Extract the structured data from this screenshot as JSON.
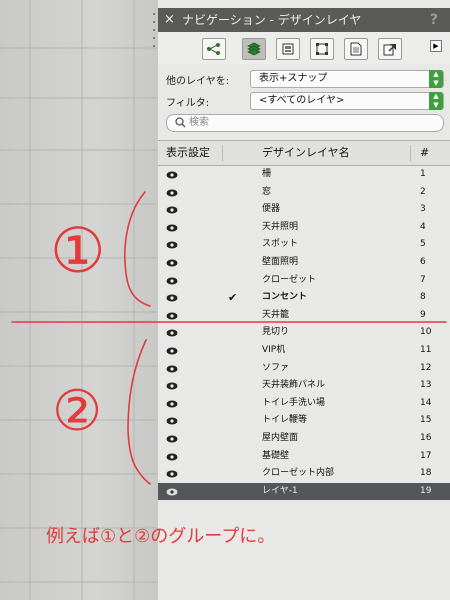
{
  "panel": {
    "close_glyph": "×",
    "title": "ナビゲーション - デザインレイヤ",
    "help_glyph": "?"
  },
  "toolbar": {
    "buttons": [
      {
        "icon": "hierarchy-icon"
      },
      {
        "icon": "layers-icon",
        "active": true
      },
      {
        "icon": "sheet-icon"
      },
      {
        "icon": "viewport-icon"
      },
      {
        "icon": "document-icon"
      },
      {
        "icon": "export-icon"
      }
    ],
    "arrow_glyph": "▶"
  },
  "other_layers": {
    "label": "他のレイヤを:",
    "value": "表示+スナップ"
  },
  "filter": {
    "label": "フィルタ:",
    "value": "<すべてのレイヤ>"
  },
  "search": {
    "placeholder": "検索"
  },
  "header": {
    "visibility": "表示設定",
    "name": "デザインレイヤ名",
    "number": "#"
  },
  "layers": [
    {
      "name": "柵",
      "number": "1",
      "checked": false,
      "selected": false
    },
    {
      "name": "窓",
      "number": "2",
      "checked": false,
      "selected": false
    },
    {
      "name": "便器",
      "number": "3",
      "checked": false,
      "selected": false
    },
    {
      "name": "天井照明",
      "number": "4",
      "checked": false,
      "selected": false
    },
    {
      "name": "スポット",
      "number": "5",
      "checked": false,
      "selected": false
    },
    {
      "name": "壁面照明",
      "number": "6",
      "checked": false,
      "selected": false
    },
    {
      "name": "クローゼット",
      "number": "7",
      "checked": false,
      "selected": false
    },
    {
      "name": "コンセント",
      "number": "8",
      "checked": true,
      "selected": false
    },
    {
      "name": "天井籠",
      "number": "9",
      "checked": false,
      "selected": false
    },
    {
      "name": "見切り",
      "number": "10",
      "checked": false,
      "selected": false
    },
    {
      "name": "VIP机",
      "number": "11",
      "checked": false,
      "selected": false
    },
    {
      "name": "ソファ",
      "number": "12",
      "checked": false,
      "selected": false
    },
    {
      "name": "天井装飾パネル",
      "number": "13",
      "checked": false,
      "selected": false
    },
    {
      "name": "トイレ手洗い場",
      "number": "14",
      "checked": false,
      "selected": false
    },
    {
      "name": "トイレ鞭等",
      "number": "15",
      "checked": false,
      "selected": false
    },
    {
      "name": "屋内壁面",
      "number": "16",
      "checked": false,
      "selected": false
    },
    {
      "name": "基礎壁",
      "number": "17",
      "checked": false,
      "selected": false
    },
    {
      "name": "クローゼット内部",
      "number": "18",
      "checked": false,
      "selected": false
    },
    {
      "name": "レイヤ-1",
      "number": "19",
      "checked": false,
      "selected": true
    }
  ],
  "annotations": {
    "group1": "①",
    "group2": "②",
    "note": "例えば①と②のグループに。",
    "color": "#e23b3b"
  }
}
